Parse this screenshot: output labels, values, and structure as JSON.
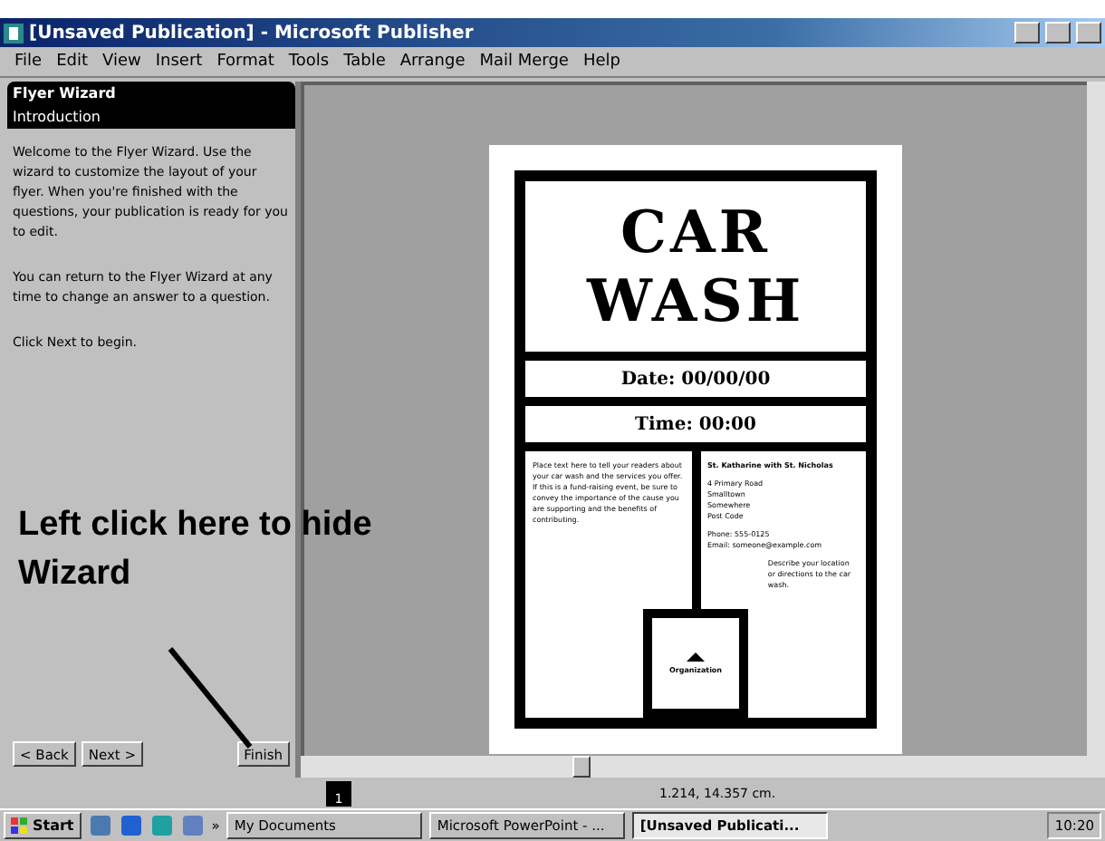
{
  "window": {
    "title": "[Unsaved Publication] - Microsoft Publisher"
  },
  "menu": [
    "File",
    "Edit",
    "View",
    "Insert",
    "Format",
    "Tools",
    "Table",
    "Arrange",
    "Mail Merge",
    "Help"
  ],
  "wizard": {
    "title": "Flyer Wizard",
    "section": "Introduction",
    "paragraphs": [
      "Welcome to the Flyer Wizard. Use the wizard to customize the layout of your flyer. When you're finished with the questions, your publication is ready for you to edit.",
      "You can return to the Flyer Wizard at any time to change an answer to a question.",
      "Click Next to begin."
    ],
    "buttons": [
      {
        "label": "< Back",
        "disabled": false
      },
      {
        "label": "Next >",
        "disabled": false
      },
      {
        "label": "Finish",
        "disabled": false
      }
    ]
  },
  "flyer": {
    "headline": "CAR WASH",
    "date": "Date: 00/00/00",
    "time": "Time: 00:00",
    "body": "Place text here to tell your readers about your car wash and the services you offer. If this is a fund-raising event, be sure to convey the importance of the cause you are supporting and the benefits of contributing.",
    "organization": "St. Katharine with St. Nicholas",
    "address": [
      "4 Primary Road",
      "Smalltown",
      "Somewhere",
      "Post Code"
    ],
    "contact": [
      "Phone: 555-0125",
      "Email: someone@example.com"
    ],
    "location": "Describe your location or directions to the car wash.",
    "logo": "Organization"
  },
  "annotation": "Left click here to hide Wizard",
  "status_bar": {
    "page": "1",
    "position": "1.214, 14.357 cm."
  },
  "taskbar": {
    "start": "Start",
    "tasks": [
      {
        "label": "My Documents",
        "selected": false
      },
      {
        "label": "Microsoft PowerPoint - ...",
        "selected": false
      },
      {
        "label": "[Unsaved Publicati...",
        "selected": true
      }
    ],
    "clock": "10:20",
    "chevron": "»"
  }
}
